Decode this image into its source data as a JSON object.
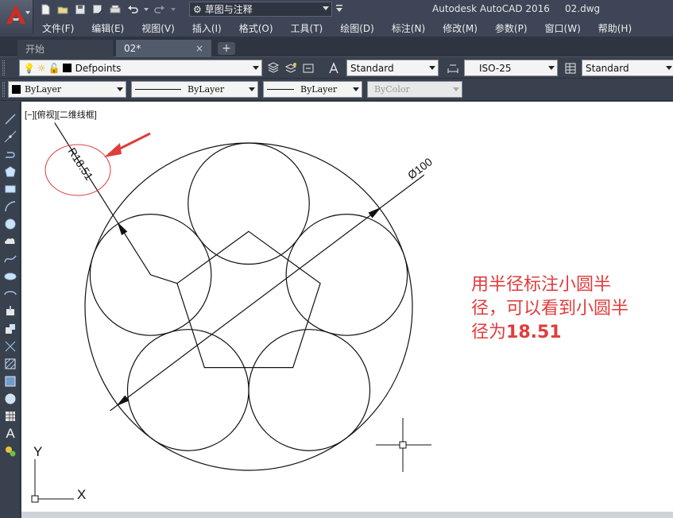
{
  "app": {
    "window_title": "Autodesk AutoCAD 2016     02.dwg",
    "workspace": "草图与注释",
    "accent_red": "#c8201e",
    "icons": [
      "autocad-logo-icon",
      "new-icon",
      "open-icon",
      "save-icon",
      "saveas-icon",
      "print-icon",
      "undo-icon",
      "redo-icon",
      "gear-icon"
    ]
  },
  "menu": {
    "items": [
      "文件(F)",
      "编辑(E)",
      "视图(V)",
      "插入(I)",
      "格式(O)",
      "工具(T)",
      "绘图(D)",
      "标注(N)",
      "修改(M)",
      "参数(P)",
      "窗口(W)",
      "帮助(H)"
    ]
  },
  "tabs": {
    "start": "开始",
    "current": "02*",
    "close": "×",
    "new": "+"
  },
  "toolbar1": {
    "layer": "Defpoints",
    "text_style": "Standard",
    "dim_style": "ISO-25",
    "table_style": "Standard"
  },
  "toolbar2": {
    "color": "ByLayer",
    "linetype": "ByLayer",
    "lineweight": "ByLayer",
    "plotstyle": "ByColor"
  },
  "viewport": {
    "label": "[−][俯视][二维线框]"
  },
  "drawing": {
    "big_circle_diameter": 100,
    "small_circle_radius": 18.51,
    "small_circle_count": 5,
    "radius_dim_text": "R18.51",
    "diameter_dim_text": "Ø100",
    "ucs_x": "X",
    "ucs_y": "Y",
    "line_color": "#111111",
    "highlight_color": "#e03c3c"
  },
  "annotation": {
    "line1": "用半径标注小圆半",
    "line2": "径，可以看到小圆半",
    "line3_prefix": "径为",
    "line3_value": "18.51"
  }
}
